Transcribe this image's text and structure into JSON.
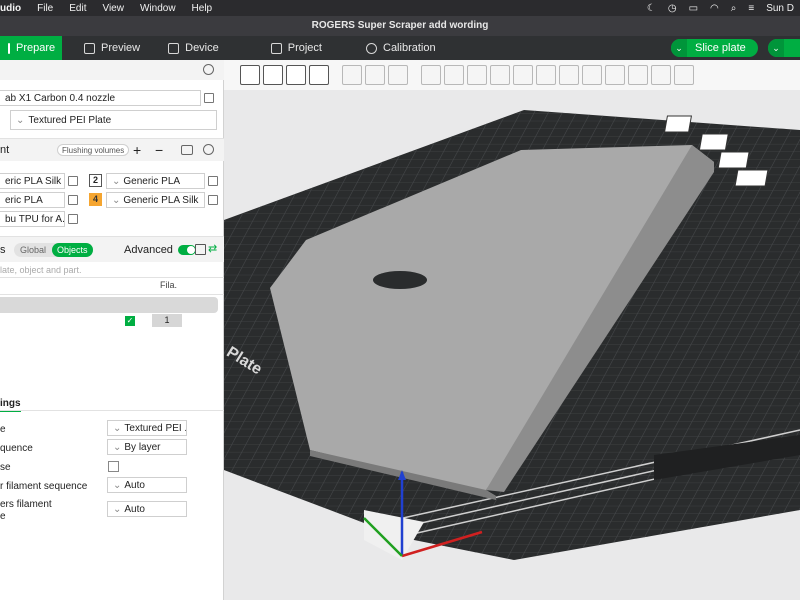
{
  "menubar": {
    "app": "udio",
    "items": [
      "File",
      "Edit",
      "View",
      "Window",
      "Help"
    ],
    "clock": "Sun D"
  },
  "window": {
    "title": "ROGERS Super Scraper add wording"
  },
  "tabs": [
    {
      "label": "Prepare",
      "icon": "prepare-icon",
      "active": true
    },
    {
      "label": "Preview",
      "icon": "preview-icon"
    },
    {
      "label": "Device",
      "icon": "device-icon"
    },
    {
      "label": "Project",
      "icon": "project-icon"
    },
    {
      "label": "Calibration",
      "icon": "calibration-icon"
    }
  ],
  "slice_button": {
    "label": "Slice plate"
  },
  "printer": {
    "name": "ab X1 Carbon 0.4 nozzle",
    "plate": "Textured PEI Plate"
  },
  "filament": {
    "header": "nt",
    "flushing_label": "Flushing volumes",
    "slots": [
      {
        "name": "eric PLA Silk"
      },
      {
        "num": "2",
        "name": "Generic PLA"
      },
      {
        "name": "eric PLA"
      },
      {
        "num": "4",
        "name": "Generic PLA Silk"
      },
      {
        "name": "bu TPU for A..."
      }
    ]
  },
  "process": {
    "header": "s",
    "global_label": "Global",
    "objects_label": "Objects",
    "advanced_label": "Advanced",
    "search_placeholder": "late, object and part.",
    "fila_header": "Fila.",
    "fila_value": "1"
  },
  "plate_settings": {
    "header": "ings",
    "rows": [
      {
        "label": "e",
        "value": "Textured PEI ..."
      },
      {
        "label": "quence",
        "value": "By layer"
      },
      {
        "label": "se",
        "value": ""
      },
      {
        "label": "r filament sequence",
        "value": "Auto"
      },
      {
        "label": "ers filament",
        "label2": "e",
        "value": "Auto"
      }
    ]
  },
  "bed": {
    "label": "Plate"
  },
  "colors": {
    "accent": "#00ae42",
    "orange": "#f5a530",
    "bed": "#2a2c2d",
    "model": "#a9a9a9"
  }
}
